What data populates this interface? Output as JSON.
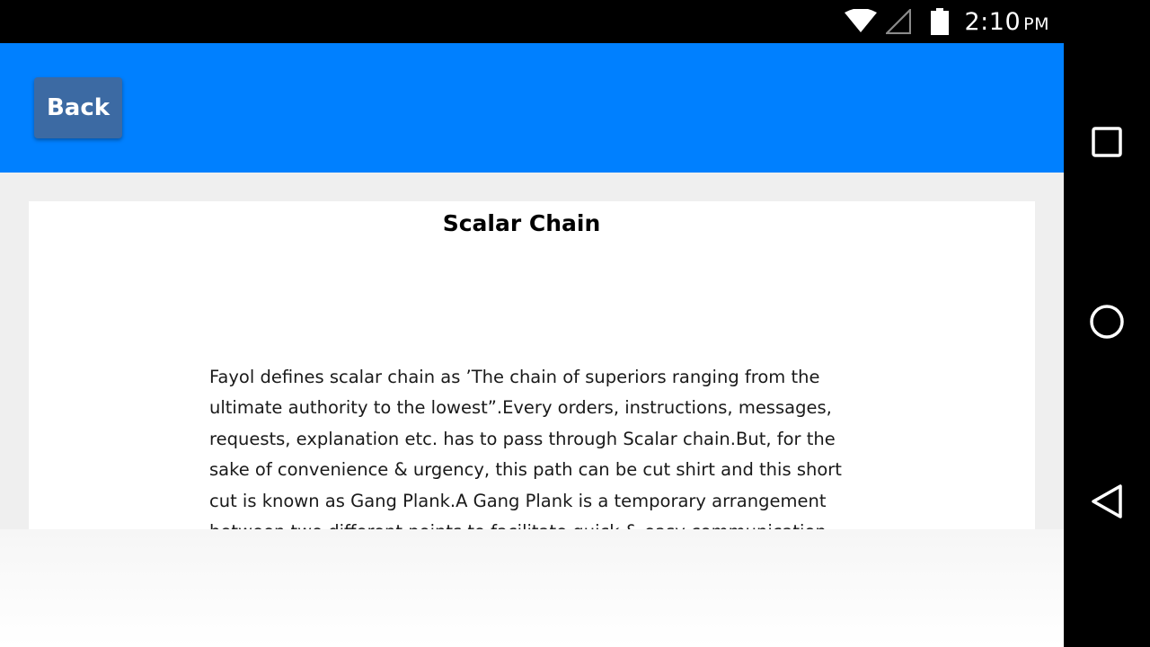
{
  "status_bar": {
    "time": "2:10",
    "ampm": "PM",
    "icons": [
      "wifi-icon",
      "cellular-signal-icon",
      "battery-icon"
    ]
  },
  "toolbar": {
    "back_label": "Back",
    "color": "#0080ff",
    "button_color": "#3c6aa3"
  },
  "document": {
    "title": "Scalar Chain",
    "body": "Fayol defines scalar chain as ’The chain of superiors ranging from the ultimate authority to the lowest”.Every orders, instructions, messages, requests, explanation etc. has to pass through Scalar chain.But, for the sake of convenience & urgency, this path can be cut shirt and this short cut is known as Gang Plank.A Gang Plank is a temporary arrangement between two different points to facilitate quick & easy communication"
  },
  "nav_bar": {
    "buttons": [
      "recents-icon",
      "home-icon",
      "back-triangle-icon"
    ]
  }
}
